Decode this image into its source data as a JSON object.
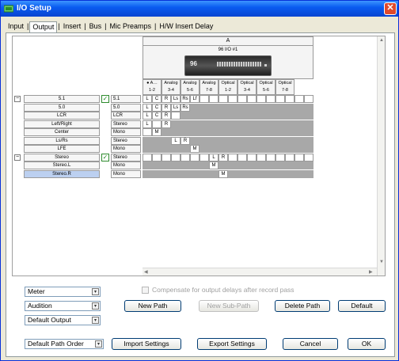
{
  "window": {
    "title": "I/O Setup",
    "close_glyph": "✕"
  },
  "tabs": [
    {
      "label": "Input"
    },
    {
      "label": "Output"
    },
    {
      "label": "Insert"
    },
    {
      "label": "Bus"
    },
    {
      "label": "Mic Preamps"
    },
    {
      "label": "H/W Insert Delay"
    }
  ],
  "tab_separator": "|",
  "grid": {
    "interface_label": "A",
    "device_name": "96 I/O #1",
    "device_logo": "96",
    "columns": [
      {
        "l1": "● A…",
        "l2": "1-2"
      },
      {
        "l1": "Analog",
        "l2": "3-4"
      },
      {
        "l1": "Analog",
        "l2": "5-6"
      },
      {
        "l1": "Analog",
        "l2": "7-8"
      },
      {
        "l1": "Optical",
        "l2": "1-2"
      },
      {
        "l1": "Optical",
        "l2": "3-4"
      },
      {
        "l1": "Optical",
        "l2": "5-6"
      },
      {
        "l1": "Optical",
        "l2": "7-8"
      }
    ],
    "rows": [
      {
        "name": "5.1",
        "fmt": "5.1",
        "expand": "⊟",
        "checked": true,
        "selected": false,
        "cells": [
          "L",
          "C",
          "R",
          "Ls",
          "Rs",
          "Lf",
          "",
          "",
          "",
          "",
          "",
          "",
          "",
          "",
          "",
          "",
          "",
          ""
        ]
      },
      {
        "name": "5.0",
        "fmt": "5.0",
        "expand": "",
        "checked": false,
        "selected": false,
        "cells": [
          "L",
          "C",
          "R",
          "Ls",
          "Rs",
          "#",
          "#",
          "#",
          "#",
          "#",
          "#",
          "#",
          "#",
          "#",
          "#",
          "#",
          "#",
          "#"
        ]
      },
      {
        "name": "LCR",
        "fmt": "LCR",
        "expand": "",
        "checked": false,
        "selected": false,
        "cells": [
          "L",
          "C",
          "R",
          "",
          "#",
          "#",
          "#",
          "#",
          "#",
          "#",
          "#",
          "#",
          "#",
          "#",
          "#",
          "#",
          "#",
          "#"
        ]
      },
      {
        "name": "Left/Right",
        "fmt": "Stereo",
        "expand": "",
        "checked": false,
        "selected": false,
        "cells": [
          "L",
          "",
          "R",
          "#",
          "#",
          "#",
          "#",
          "#",
          "#",
          "#",
          "#",
          "#",
          "#",
          "#",
          "#",
          "#",
          "#",
          "#"
        ]
      },
      {
        "name": "Center",
        "fmt": "Mono",
        "expand": "",
        "checked": false,
        "selected": false,
        "cells": [
          "",
          "M",
          "#",
          "#",
          "#",
          "#",
          "#",
          "#",
          "#",
          "#",
          "#",
          "#",
          "#",
          "#",
          "#",
          "#",
          "#",
          "#"
        ]
      },
      {
        "name": "Ls/Rs",
        "fmt": "Stereo",
        "expand": "",
        "checked": false,
        "selected": false,
        "cells": [
          "#",
          "#",
          "#",
          "L",
          "R",
          "#",
          "#",
          "#",
          "#",
          "#",
          "#",
          "#",
          "#",
          "#",
          "#",
          "#",
          "#",
          "#"
        ]
      },
      {
        "name": "LFE",
        "fmt": "Mono",
        "expand": "",
        "checked": false,
        "selected": false,
        "cells": [
          "#",
          "#",
          "#",
          "#",
          "#",
          "M",
          "#",
          "#",
          "#",
          "#",
          "#",
          "#",
          "#",
          "#",
          "#",
          "#",
          "#",
          "#"
        ]
      },
      {
        "name": "Stereo",
        "fmt": "Stereo",
        "expand": "⊟",
        "checked": true,
        "selected": false,
        "cells": [
          "",
          "",
          "",
          "",
          "",
          "",
          "",
          "L",
          "R",
          "",
          "",
          "",
          "",
          "",
          "",
          "",
          "",
          ""
        ]
      },
      {
        "name": "Stereo.L",
        "fmt": "Mono",
        "expand": "",
        "checked": false,
        "selected": false,
        "cells": [
          "#",
          "#",
          "#",
          "#",
          "#",
          "#",
          "#",
          "M",
          "#",
          "#",
          "#",
          "#",
          "#",
          "#",
          "#",
          "#",
          "#",
          "#"
        ]
      },
      {
        "name": "Stereo.R",
        "fmt": "Mono",
        "expand": "",
        "checked": false,
        "selected": true,
        "cells": [
          "#",
          "#",
          "#",
          "#",
          "#",
          "#",
          "#",
          "#",
          "M",
          "#",
          "#",
          "#",
          "#",
          "#",
          "#",
          "#",
          "#",
          "#"
        ]
      }
    ]
  },
  "compensate_label": "Compensate for output delays after record pass",
  "controls": {
    "meter": "Meter",
    "audition": "Audition",
    "default_output": "Default Output",
    "default_path_order": "Default Path Order",
    "dropdown_glyph": "▾"
  },
  "buttons": {
    "new_path": "New Path",
    "new_sub_path": "New Sub-Path",
    "delete_path": "Delete Path",
    "default": "Default",
    "import_settings": "Import Settings",
    "export_settings": "Export Settings",
    "cancel": "Cancel",
    "ok": "OK"
  },
  "scroll_glyphs": {
    "up": "▲",
    "down": "▼",
    "left": "◀",
    "right": "▶"
  },
  "colors": {
    "titlebar": "#0a5cf0",
    "selected_row": "#bcd0f0",
    "unavailable_cell": "#a8a8a8",
    "check": "#1e8a1e"
  }
}
